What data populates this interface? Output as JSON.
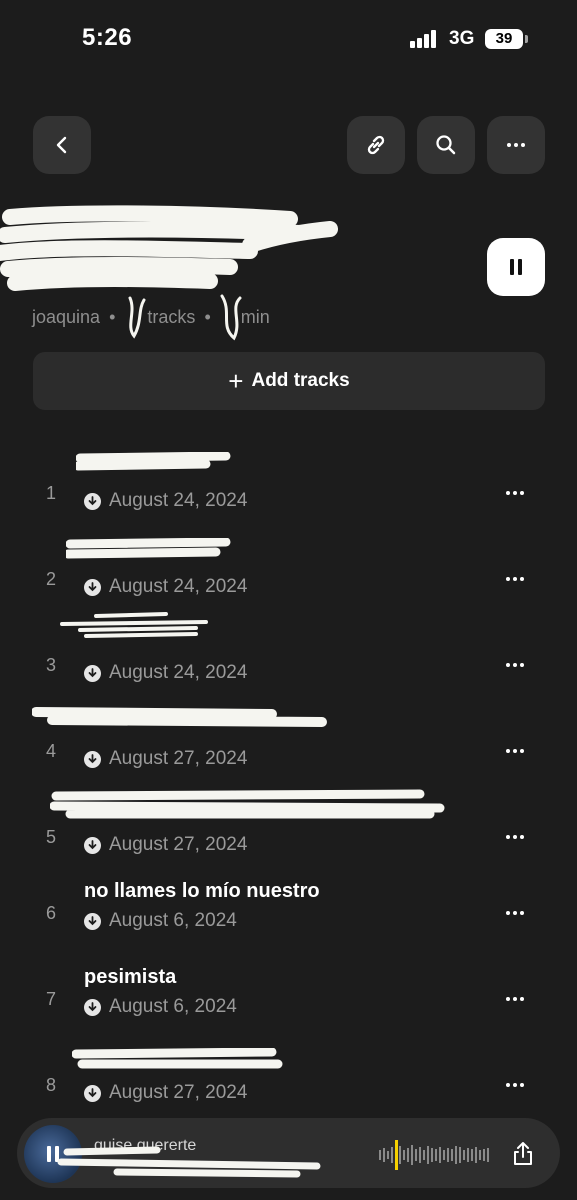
{
  "status_bar": {
    "time": "5:26",
    "network": "3G",
    "battery": "39"
  },
  "header": {
    "meta_user": "joaquina",
    "meta_tracks": "tracks",
    "meta_duration": "min",
    "separator": "•"
  },
  "icons": {
    "back": "chevron-left-icon",
    "link": "link-icon",
    "search": "search-icon",
    "more": "more-horizontal-icon",
    "pause": "pause-icon",
    "download": "download-circle-icon",
    "share": "share-icon"
  },
  "add_tracks": {
    "label": "Add tracks"
  },
  "tracks": [
    {
      "num": "1",
      "title": "",
      "date": "August 24, 2024"
    },
    {
      "num": "2",
      "title": "",
      "date": "August 24, 2024"
    },
    {
      "num": "3",
      "title": "",
      "date": "August 24, 2024"
    },
    {
      "num": "4",
      "title": "",
      "date": "August 27, 2024"
    },
    {
      "num": "5",
      "title": "",
      "date": "August 27, 2024"
    },
    {
      "num": "6",
      "title": "no llames lo mío nuestro",
      "date": "August 6, 2024"
    },
    {
      "num": "7",
      "title": "pesimista",
      "date": "August 6, 2024"
    },
    {
      "num": "8",
      "title": "",
      "date": "August 27, 2024"
    }
  ],
  "now_playing": {
    "title": "quise quererte"
  },
  "colors": {
    "background": "#1c1c1c",
    "button": "#333333",
    "accent_playhead": "#f5d000"
  }
}
